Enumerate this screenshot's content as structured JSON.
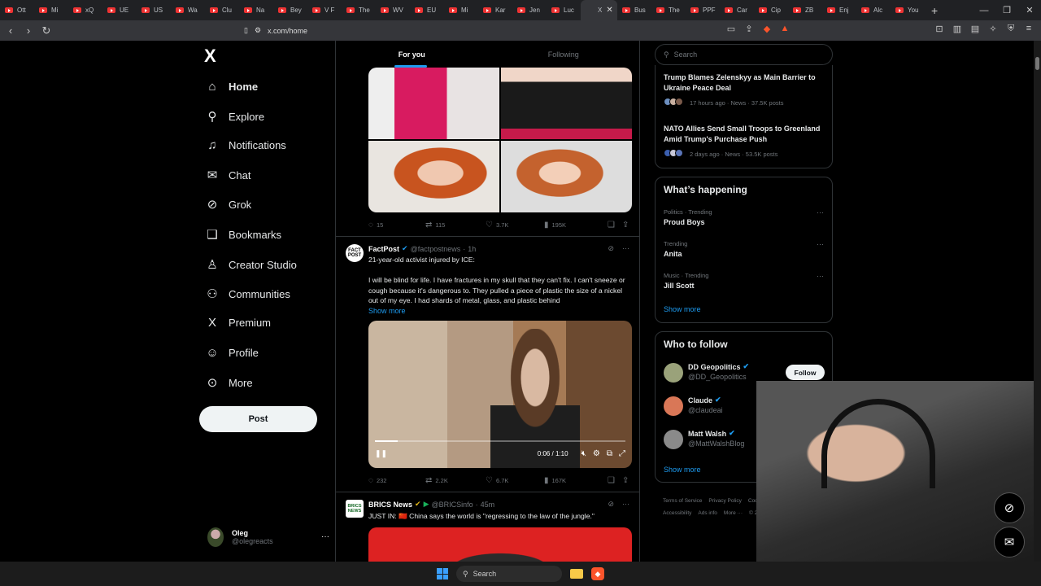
{
  "browser": {
    "tabs": [
      {
        "label": "Ott"
      },
      {
        "label": "Mi"
      },
      {
        "label": "xQ"
      },
      {
        "label": "UE"
      },
      {
        "label": "US"
      },
      {
        "label": "Wa"
      },
      {
        "label": "Clu"
      },
      {
        "label": "Na"
      },
      {
        "label": "Bey"
      },
      {
        "label": "V F"
      },
      {
        "label": "The"
      },
      {
        "label": "WV"
      },
      {
        "label": "EU"
      },
      {
        "label": "Mi"
      },
      {
        "label": "Kar"
      },
      {
        "label": "Jen"
      },
      {
        "label": "Luc"
      },
      {
        "label": "X",
        "active": true
      },
      {
        "label": "Bus"
      },
      {
        "label": "The"
      },
      {
        "label": "PPF"
      },
      {
        "label": "Car"
      },
      {
        "label": "Cip"
      },
      {
        "label": "ZB"
      },
      {
        "label": "Enj"
      },
      {
        "label": "Alc"
      },
      {
        "label": "You"
      }
    ],
    "url": "x.com/home"
  },
  "sidebar": {
    "logo": "X",
    "items": [
      {
        "label": "Home",
        "icon": "home-icon",
        "glyph": "⌂"
      },
      {
        "label": "Explore",
        "icon": "search-icon",
        "glyph": "⚲"
      },
      {
        "label": "Notifications",
        "icon": "bell-icon",
        "glyph": "♫"
      },
      {
        "label": "Chat",
        "icon": "mail-icon",
        "glyph": "✉"
      },
      {
        "label": "Grok",
        "icon": "grok-icon",
        "glyph": "⊘"
      },
      {
        "label": "Bookmarks",
        "icon": "bookmark-icon",
        "glyph": "❑"
      },
      {
        "label": "Creator Studio",
        "icon": "flask-icon",
        "glyph": "♙"
      },
      {
        "label": "Communities",
        "icon": "people-icon",
        "glyph": "⚇"
      },
      {
        "label": "Premium",
        "icon": "x-icon",
        "glyph": "X"
      },
      {
        "label": "Profile",
        "icon": "person-icon",
        "glyph": "☺"
      },
      {
        "label": "More",
        "icon": "more-circle-icon",
        "glyph": "⊙"
      }
    ],
    "post_button": "Post",
    "account": {
      "name": "Oleg",
      "handle": "@olegreacts"
    }
  },
  "feed": {
    "tabs": [
      "For you",
      "Following"
    ],
    "post1_actions": {
      "replies": "15",
      "reposts": "115",
      "likes": "3.7K",
      "views": "195K"
    },
    "post2": {
      "avatar_text": "FACT POST",
      "name": "FactPost",
      "handle": "@factpostnews",
      "time": "1h",
      "headline": "21-year-old activist injured by ICE:",
      "body": "I will be blind for life. I have fractures in my skull that they can't fix. I can't sneeze or cough because it's dangerous to. They pulled a piece of plastic the size of a nickel out of my eye. I had shards of metal, glass, and plastic behind",
      "show_more": "Show more",
      "video_time": "0:06 / 1:10",
      "video_progress": 0.09,
      "actions": {
        "replies": "232",
        "reposts": "2.2K",
        "likes": "6.7K",
        "views": "167K"
      }
    },
    "post3": {
      "avatar_text": "BRICS NEWS",
      "name": "BRICS News",
      "handle": "@BRICSinfo",
      "time": "45m",
      "text": "JUST IN: 🇨🇳 China says the world is \"regressing to the law of the jungle.\""
    }
  },
  "right": {
    "search_placeholder": "Search",
    "news": [
      {
        "title": "Trump Blames Zelenskyy as Main Barrier to Ukraine Peace Deal",
        "meta": "17 hours ago · News · 37.5K posts"
      },
      {
        "title": "NATO Allies Send Small Troops to Greenland Amid Trump's Purchase Push",
        "meta": "2 days ago · News · 53.5K posts"
      }
    ],
    "happening": {
      "title": "What’s happening",
      "trends": [
        {
          "category": "Politics · Trending",
          "name": "Proud Boys"
        },
        {
          "category": "Trending",
          "name": "Anita"
        },
        {
          "category": "Music · Trending",
          "name": "Jill Scott"
        }
      ],
      "show_more": "Show more"
    },
    "who_to_follow": {
      "title": "Who to follow",
      "accounts": [
        {
          "name": "DD Geopolitics",
          "handle": "@DD_Geopolitics",
          "button": "Follow",
          "color": "#9aa27a"
        },
        {
          "name": "Claude",
          "handle": "@claudeai",
          "button": "Follow",
          "color": "#d97757"
        },
        {
          "name": "Matt Walsh",
          "handle": "@MattWalshBlog",
          "button": "Follow",
          "color": "#8a8a8a"
        }
      ],
      "show_more": "Show more"
    },
    "footer": [
      "Terms of Service",
      "Privacy Policy",
      "Cookie P",
      "Accessibility",
      "Ads info",
      "More ···",
      "© 2026"
    ]
  },
  "taskbar": {
    "search": "Search"
  },
  "colors": {
    "accent": "#1d9bf0",
    "background": "#000000",
    "border": "#2f3336"
  }
}
